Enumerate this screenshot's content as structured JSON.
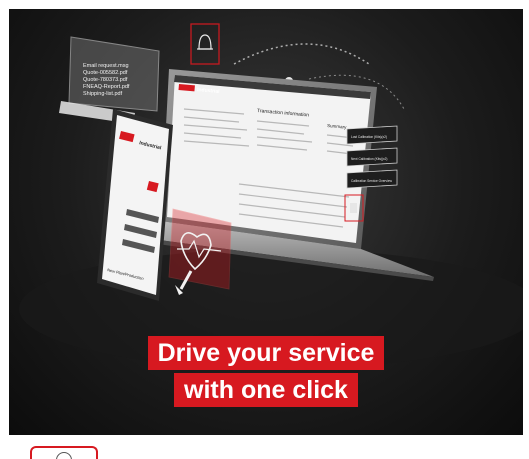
{
  "headline": {
    "line1": "Drive your service",
    "line2": "with one click"
  },
  "files_panel": {
    "items": [
      "Email request.msg",
      "Quote-005582.pdf",
      "Quote-780373.pdf",
      "FNEAQ-Report.pdf",
      "Shipping-list.pdf"
    ]
  },
  "right_buttons": [
    "Lost Calibration (Kits)(x2)",
    "Next Calibration (Kits)(x2)",
    "Calibration Service Overview"
  ],
  "laptop": {
    "brand": "Industrial",
    "section_title": "Transaction information",
    "summary_label": "Summary"
  },
  "phone": {
    "brand": "Industrial",
    "footer_title": "New Plan/Production"
  },
  "colors": {
    "accent": "#d71920",
    "background": "#1c1c1c"
  },
  "icons": [
    "bell-icon",
    "gear-icon",
    "heart-pulse-icon",
    "upload-icon",
    "power-icon"
  ]
}
